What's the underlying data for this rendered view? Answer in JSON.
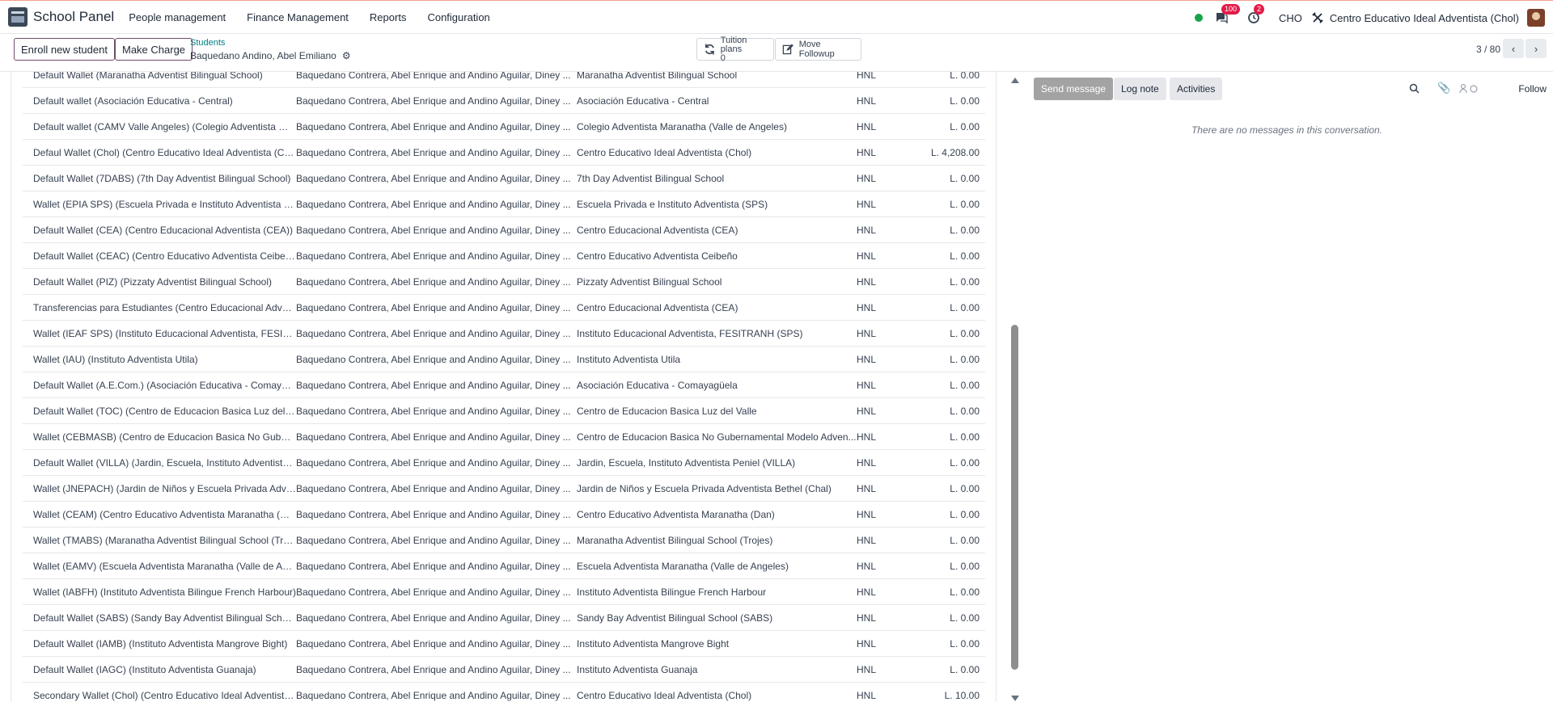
{
  "topbar": {
    "app_name": "School Panel",
    "menu": [
      "People management",
      "Finance Management",
      "Reports",
      "Configuration"
    ],
    "messages_badge": "100",
    "activities_badge": "2",
    "user_code": "CHO",
    "company": "Centro Educativo Ideal Adventista (Chol)",
    "status_color": "#16a34a"
  },
  "controlbar": {
    "enroll_label": "Enroll new student",
    "charge_label": "Make Charge",
    "breadcrumb_parent": "Students",
    "breadcrumb_current": "Baquedano Andino, Abel Emiliano",
    "tuition_label": "Tuition plans",
    "tuition_count": "0",
    "followup_label": "Move Followup",
    "pager": "3 / 80"
  },
  "wallets": {
    "rows": [
      {
        "name": "Default Wallet (Maranatha Adventist Bilingual School)",
        "partner": "Baquedano Contrera, Abel Enrique and Andino Aguilar, Diney ...",
        "institution": "Maranatha Adventist Bilingual School",
        "currency": "HNL",
        "amount": "L. 0.00"
      },
      {
        "name": "Default wallet (Asociación Educativa - Central)",
        "partner": "Baquedano Contrera, Abel Enrique and Andino Aguilar, Diney ...",
        "institution": "Asociación Educativa - Central",
        "currency": "HNL",
        "amount": "L. 0.00"
      },
      {
        "name": "Default wallet (CAMV Valle Angeles) (Colegio Adventista Mar...",
        "partner": "Baquedano Contrera, Abel Enrique and Andino Aguilar, Diney ...",
        "institution": "Colegio Adventista Maranatha (Valle de Angeles)",
        "currency": "HNL",
        "amount": "L. 0.00"
      },
      {
        "name": "Defaul Wallet (Chol) (Centro Educativo Ideal Adventista (Chol))",
        "partner": "Baquedano Contrera, Abel Enrique and Andino Aguilar, Diney ...",
        "institution": "Centro Educativo Ideal Adventista (Chol)",
        "currency": "HNL",
        "amount": "L. 4,208.00"
      },
      {
        "name": "Default Wallet (7DABS) (7th Day Adventist Bilingual School)",
        "partner": "Baquedano Contrera, Abel Enrique and Andino Aguilar, Diney ...",
        "institution": "7th Day Adventist Bilingual School",
        "currency": "HNL",
        "amount": "L. 0.00"
      },
      {
        "name": "Wallet (EPIA SPS) (Escuela Privada e Instituto Adventista (SPS))",
        "partner": "Baquedano Contrera, Abel Enrique and Andino Aguilar, Diney ...",
        "institution": "Escuela Privada e Instituto Adventista (SPS)",
        "currency": "HNL",
        "amount": "L. 0.00"
      },
      {
        "name": "Default Wallet (CEA) (Centro Educacional Adventista (CEA))",
        "partner": "Baquedano Contrera, Abel Enrique and Andino Aguilar, Diney ...",
        "institution": "Centro Educacional Adventista (CEA)",
        "currency": "HNL",
        "amount": "L. 0.00"
      },
      {
        "name": "Default Wallet (CEAC) (Centro Educativo Adventista Ceibeño)",
        "partner": "Baquedano Contrera, Abel Enrique and Andino Aguilar, Diney ...",
        "institution": "Centro Educativo Adventista Ceibeño",
        "currency": "HNL",
        "amount": "L. 0.00"
      },
      {
        "name": "Default Wallet (PIZ) (Pizzaty Adventist Bilingual School)",
        "partner": "Baquedano Contrera, Abel Enrique and Andino Aguilar, Diney ...",
        "institution": "Pizzaty Adventist Bilingual School",
        "currency": "HNL",
        "amount": "L. 0.00"
      },
      {
        "name": "Transferencias para Estudiantes (Centro Educacional Adventis...",
        "partner": "Baquedano Contrera, Abel Enrique and Andino Aguilar, Diney ...",
        "institution": "Centro Educacional Adventista (CEA)",
        "currency": "HNL",
        "amount": "L. 0.00"
      },
      {
        "name": "Wallet (IEAF SPS) (Instituto Educacional Adventista, FESITRAN...",
        "partner": "Baquedano Contrera, Abel Enrique and Andino Aguilar, Diney ...",
        "institution": "Instituto Educacional Adventista, FESITRANH (SPS)",
        "currency": "HNL",
        "amount": "L. 0.00"
      },
      {
        "name": "Wallet (IAU) (Instituto Adventista Utila)",
        "partner": "Baquedano Contrera, Abel Enrique and Andino Aguilar, Diney ...",
        "institution": "Instituto Adventista Utila",
        "currency": "HNL",
        "amount": "L. 0.00"
      },
      {
        "name": "Default Wallet (A.E.Com.) (Asociación Educativa - Comayagüe...",
        "partner": "Baquedano Contrera, Abel Enrique and Andino Aguilar, Diney ...",
        "institution": "Asociación Educativa - Comayagüela",
        "currency": "HNL",
        "amount": "L. 0.00"
      },
      {
        "name": "Default Wallet (TOC) (Centro de Educacion Basica Luz del Valle)",
        "partner": "Baquedano Contrera, Abel Enrique and Andino Aguilar, Diney ...",
        "institution": "Centro de Educacion Basica Luz del Valle",
        "currency": "HNL",
        "amount": "L. 0.00"
      },
      {
        "name": "Wallet (CEBMASB) (Centro de Educacion Basica No Guberna...",
        "partner": "Baquedano Contrera, Abel Enrique and Andino Aguilar, Diney ...",
        "institution": "Centro de Educacion Basica No Gubernamental Modelo Adven...",
        "currency": "HNL",
        "amount": "L. 0.00"
      },
      {
        "name": "Default Wallet (VILLA) (Jardin, Escuela, Instituto Adventista Pe...",
        "partner": "Baquedano Contrera, Abel Enrique and Andino Aguilar, Diney ...",
        "institution": "Jardin, Escuela, Instituto Adventista Peniel (VILLA)",
        "currency": "HNL",
        "amount": "L. 0.00"
      },
      {
        "name": "Wallet (JNEPACH) (Jardin de Niños y Escuela Privada Adventis...",
        "partner": "Baquedano Contrera, Abel Enrique and Andino Aguilar, Diney ...",
        "institution": "Jardin de Niños y Escuela Privada Adventista Bethel (Chal)",
        "currency": "HNL",
        "amount": "L. 0.00"
      },
      {
        "name": "Wallet (CEAM) (Centro Educativo Adventista Maranatha (Dan))",
        "partner": "Baquedano Contrera, Abel Enrique and Andino Aguilar, Diney ...",
        "institution": "Centro Educativo Adventista Maranatha (Dan)",
        "currency": "HNL",
        "amount": "L. 0.00"
      },
      {
        "name": "Wallet (TMABS) (Maranatha Adventist Bilingual School (Trojes))",
        "partner": "Baquedano Contrera, Abel Enrique and Andino Aguilar, Diney ...",
        "institution": "Maranatha Adventist Bilingual School (Trojes)",
        "currency": "HNL",
        "amount": "L. 0.00"
      },
      {
        "name": "Wallet (EAMV) (Escuela Adventista Maranatha (Valle de Angel...",
        "partner": "Baquedano Contrera, Abel Enrique and Andino Aguilar, Diney ...",
        "institution": "Escuela Adventista Maranatha (Valle de Angeles)",
        "currency": "HNL",
        "amount": "L. 0.00"
      },
      {
        "name": "Wallet (IABFH) (Instituto Adventista Bilingue French Harbour)",
        "partner": "Baquedano Contrera, Abel Enrique and Andino Aguilar, Diney ...",
        "institution": "Instituto Adventista Bilingue French Harbour",
        "currency": "HNL",
        "amount": "L. 0.00"
      },
      {
        "name": "Default Wallet (SABS) (Sandy Bay Adventist Bilingual School (...",
        "partner": "Baquedano Contrera, Abel Enrique and Andino Aguilar, Diney ...",
        "institution": "Sandy Bay Adventist Bilingual School (SABS)",
        "currency": "HNL",
        "amount": "L. 0.00"
      },
      {
        "name": "Default Wallet (IAMB) (Instituto Adventista Mangrove Bight)",
        "partner": "Baquedano Contrera, Abel Enrique and Andino Aguilar, Diney ...",
        "institution": "Instituto Adventista Mangrove Bight",
        "currency": "HNL",
        "amount": "L. 0.00"
      },
      {
        "name": "Default Wallet (IAGC) (Instituto Adventista Guanaja)",
        "partner": "Baquedano Contrera, Abel Enrique and Andino Aguilar, Diney ...",
        "institution": "Instituto Adventista Guanaja",
        "currency": "HNL",
        "amount": "L. 0.00"
      },
      {
        "name": "Secondary Wallet (Chol) (Centro Educativo Ideal Adventista (...",
        "partner": "Baquedano Contrera, Abel Enrique and Andino Aguilar, Diney ...",
        "institution": "Centro Educativo Ideal Adventista (Chol)",
        "currency": "HNL",
        "amount": "L. 10.00"
      }
    ]
  },
  "chatter": {
    "send_message": "Send message",
    "log_note": "Log note",
    "activities": "Activities",
    "follow": "Follow",
    "empty_text": "There are no messages in this conversation."
  }
}
